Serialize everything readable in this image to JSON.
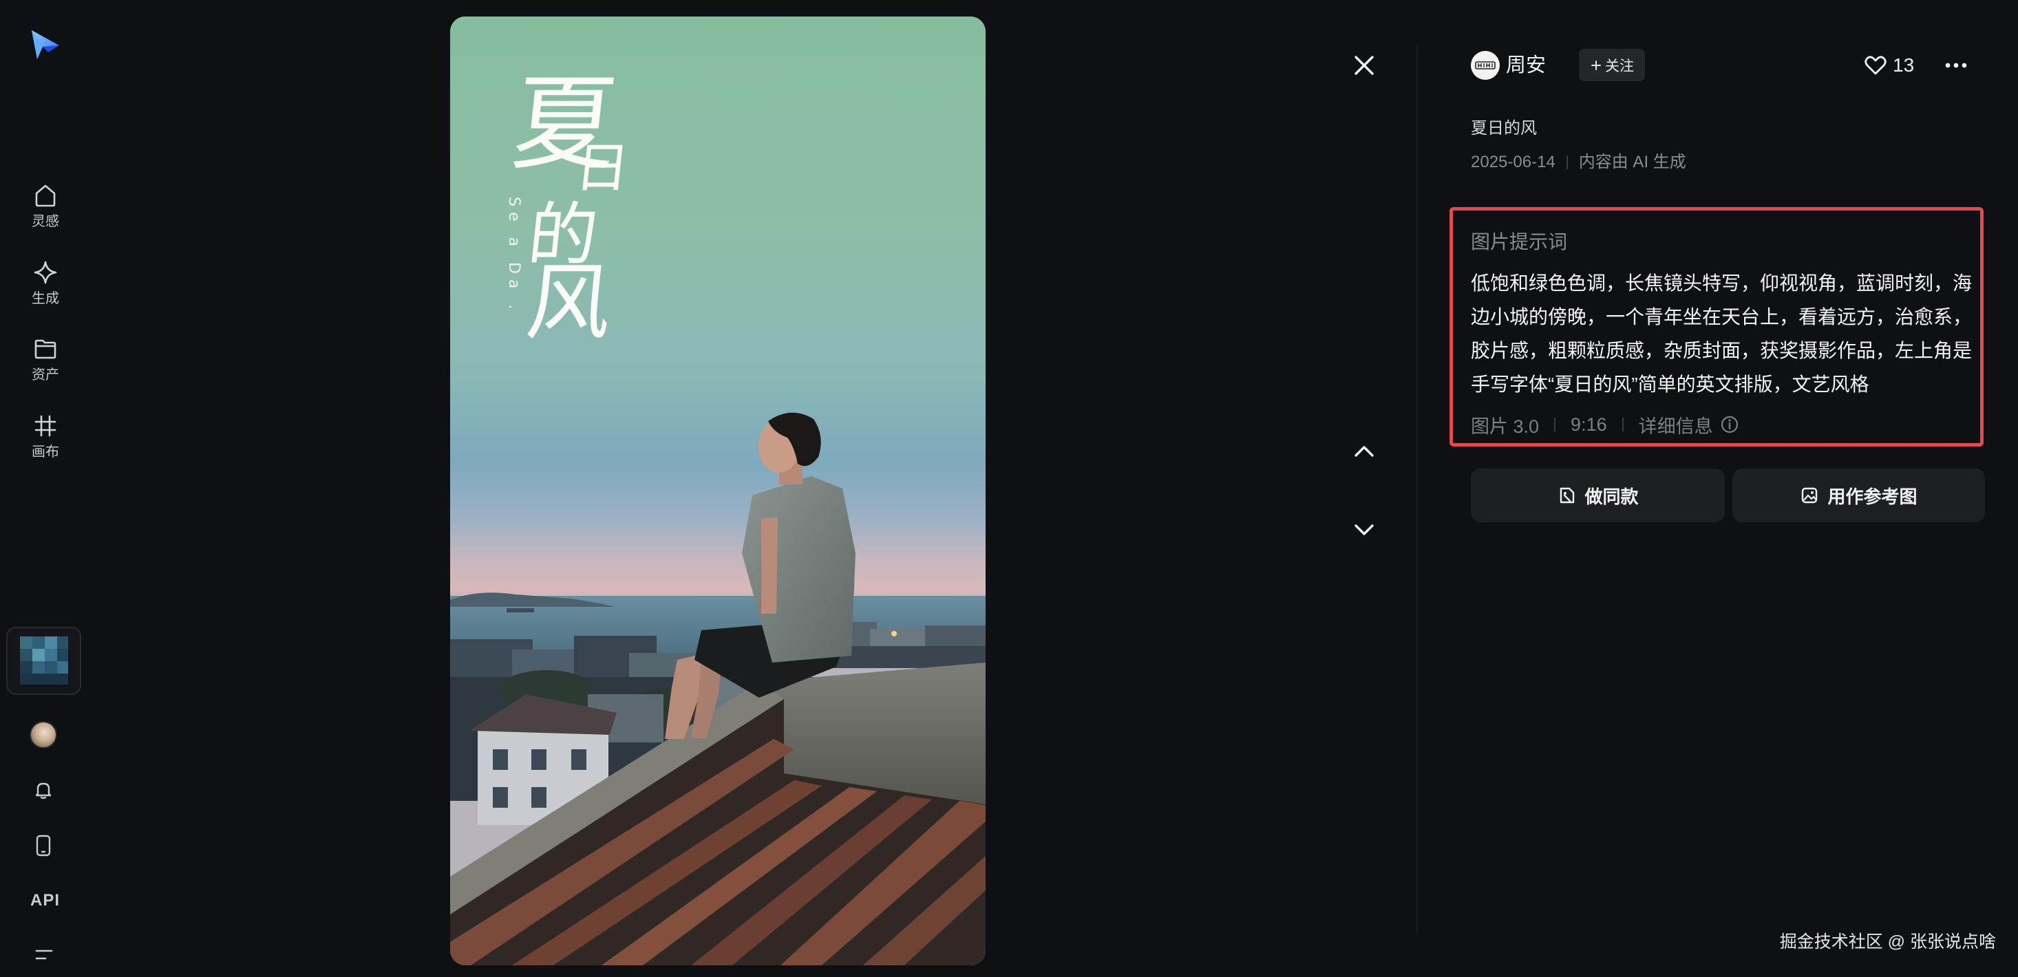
{
  "sidebar": {
    "logo_icon": "paper-plane-logo",
    "items": [
      {
        "label": "灵感",
        "icon": "home-icon"
      },
      {
        "label": "生成",
        "icon": "sparkle-icon"
      },
      {
        "label": "资产",
        "icon": "folder-icon"
      },
      {
        "label": "画布",
        "icon": "hash-grid-icon"
      }
    ],
    "api_label": "API",
    "bottom_icons": [
      "thumbnail",
      "avatar",
      "bell-icon",
      "phone-icon",
      "menu-icon"
    ]
  },
  "poster": {
    "title_chars": [
      "夏",
      "日",
      "的",
      "风"
    ],
    "side_text": "Se a Da ."
  },
  "viewer": {
    "close_icon": "close-icon",
    "prev_icon": "chevron-up-icon",
    "next_icon": "chevron-down-icon"
  },
  "author": {
    "name": "周安",
    "follow_label": "关注",
    "likes": "13"
  },
  "post": {
    "title": "夏日的风",
    "date": "2025-06-14",
    "ai_note": "内容由 AI 生成"
  },
  "prompt": {
    "heading": "图片提示词",
    "text": "低饱和绿色色调，长焦镜头特写，仰视视角，蓝调时刻，海边小城的傍晚，一个青年坐在天台上，看着远方，治愈系，胶片感，粗颗粒质感，杂质封面，获奖摄影作品，左上角是手写字体“夏日的风”简单的英文排版，文艺风格",
    "model": "图片 3.0",
    "ratio": "9:16",
    "details_label": "详细信息"
  },
  "actions": {
    "make_same": "做同款",
    "use_reference": "用作参考图"
  },
  "watermark": "掘金技术社区 @ 张张说点啥",
  "colors": {
    "background": "#0f1013",
    "highlight_border": "#e5484d",
    "button_bg": "#1e1f23",
    "logo_blue": "#3b82ff"
  }
}
